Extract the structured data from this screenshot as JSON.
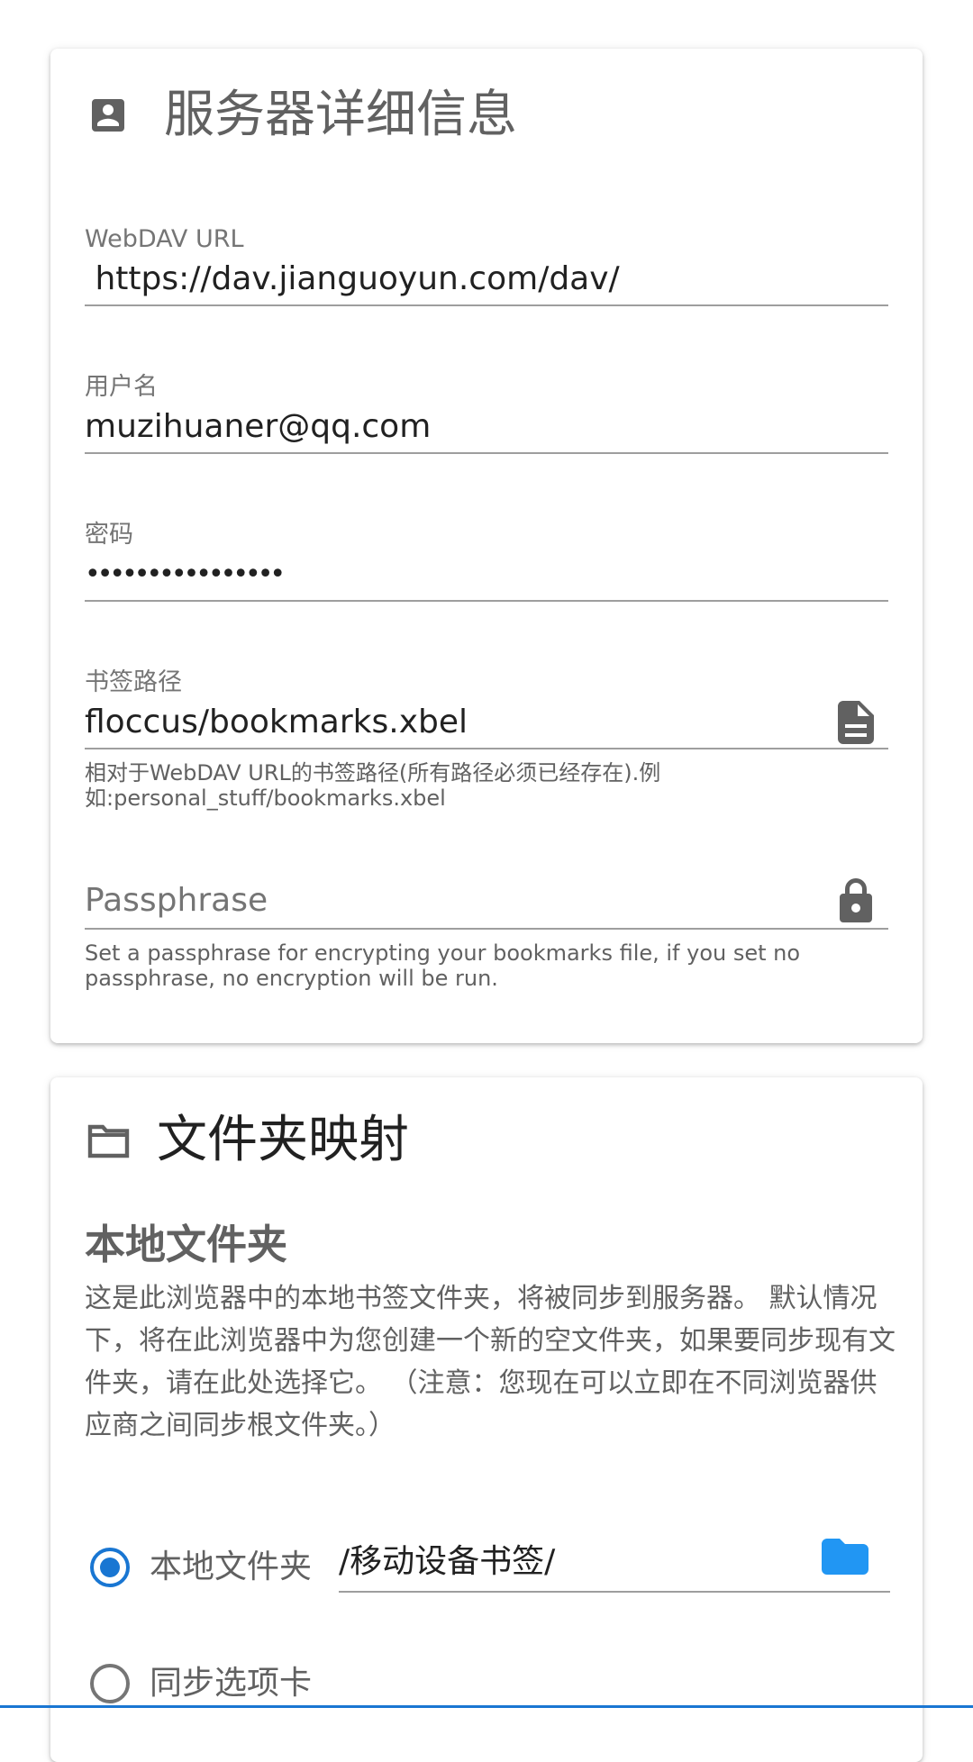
{
  "server_card": {
    "title": "服务器详细信息",
    "title_icon": "account-box-icon",
    "url_field": {
      "label": "WebDAV URL",
      "value": " https://dav.jianguoyun.com/dav/"
    },
    "username_field": {
      "label": "用户名",
      "value": "muzihuaner@qq.com"
    },
    "password_field": {
      "label": "密码",
      "value": "••••••••••••••••"
    },
    "bookmark_path_field": {
      "label": "书签路径",
      "value": "floccus/bookmarks.xbel",
      "hint": "相对于WebDAV URL的书签路径(所有路径必须已经存在).例如:personal_stuff/bookmarks.xbel",
      "icon": "file-document-icon"
    },
    "passphrase_field": {
      "placeholder": "Passphrase",
      "hint": "Set a passphrase for encrypting your bookmarks file, if you set no passphrase, no encryption will be run.",
      "icon": "lock-icon"
    }
  },
  "mapping_card": {
    "title": "文件夹映射",
    "title_icon": "folder-outline-icon",
    "local_heading": "本地文件夹",
    "local_description": "这是此浏览器中的本地书签文件夹，将被同步到服务器。 默认情况下，将在此浏览器中为您创建一个新的空文件夹，如果要同步现有文件夹，请在此处选择它。 （注意：您现在可以立即在不同浏览器供应商之间同步根文件夹。）",
    "radio_local_label": "本地文件夹",
    "local_folder_value": "/移动设备书签/",
    "radio_tabs_label": "同步选项卡"
  },
  "colors": {
    "accent": "#1976d2",
    "folder_icon": "#2196f3",
    "icon_grey": "#616161"
  }
}
